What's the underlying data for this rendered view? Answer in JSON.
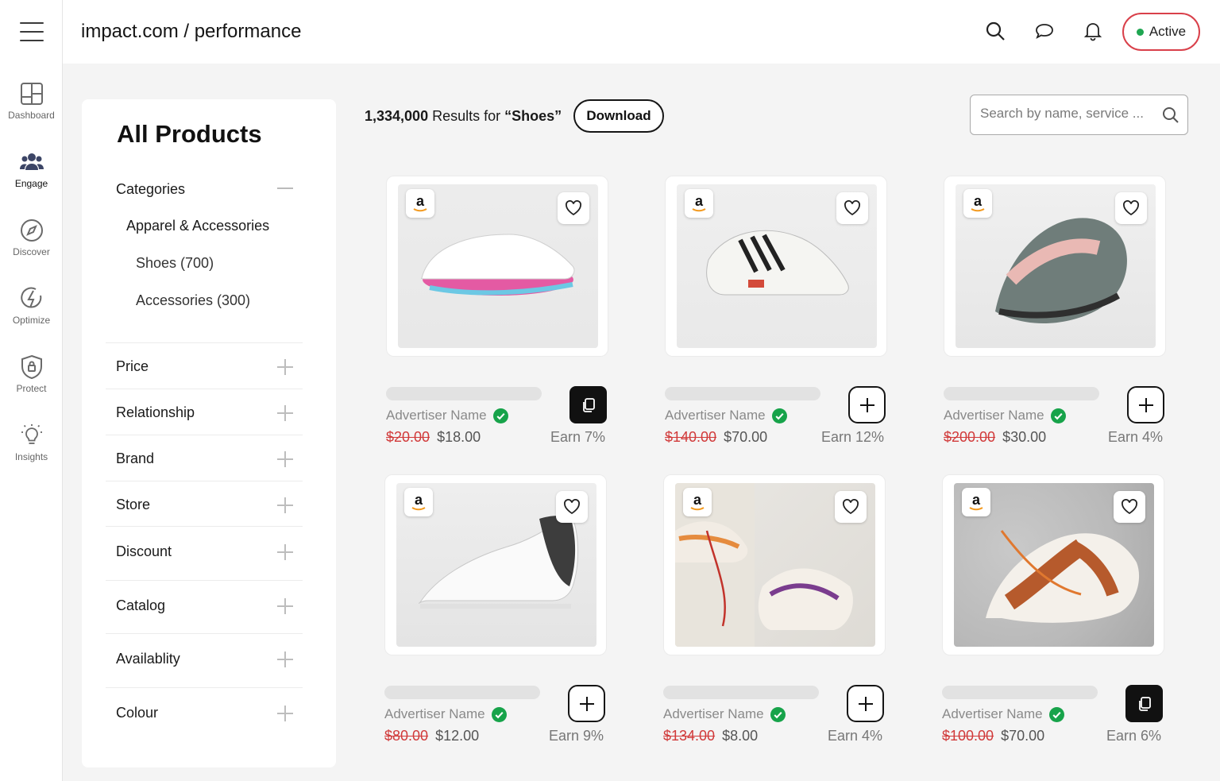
{
  "app": {
    "breadcrumb": "impact.com / performance"
  },
  "rail": {
    "items": [
      {
        "label": "Dashboard",
        "icon": "dashboard-icon"
      },
      {
        "label": "Engage",
        "icon": "users-icon"
      },
      {
        "label": "Discover",
        "icon": "compass-icon"
      },
      {
        "label": "Optimize",
        "icon": "bolt-icon"
      },
      {
        "label": "Protect",
        "icon": "shield-icon"
      },
      {
        "label": "Insights",
        "icon": "lightbulb-icon"
      }
    ]
  },
  "header": {
    "status_label": "Active",
    "status_color": "#1fa651",
    "accent": "#d9404a"
  },
  "filters": {
    "title": "All Products",
    "categories_label": "Categories",
    "category_l1": "Apparel & Accessories",
    "category_l2": [
      "Shoes (700)",
      "Accessories (300)"
    ],
    "rows": [
      "Price",
      "Relationship",
      "Brand",
      "Store",
      "Discount",
      "Catalog",
      "Availablity",
      "Colour"
    ]
  },
  "results": {
    "count": "1,334,000",
    "middle": " Results for ",
    "query": "“Shoes”",
    "download_label": "Download"
  },
  "search": {
    "placeholder": "Search by name, service ..."
  },
  "products": [
    {
      "advertiser": "Advertiser Name",
      "old_price": "$20.00",
      "price": "$18.00",
      "earn": "Earn 7%",
      "action": "copy"
    },
    {
      "advertiser": "Advertiser Name",
      "old_price": "$140.00",
      "price": "$70.00",
      "earn": "Earn 12%",
      "action": "add"
    },
    {
      "advertiser": "Advertiser Name",
      "old_price": "$200.00",
      "price": "$30.00",
      "earn": "Earn 4%",
      "action": "add"
    },
    {
      "advertiser": "Advertiser Name",
      "old_price": "$80.00",
      "price": "$12.00",
      "earn": "Earn 9%",
      "action": "add"
    },
    {
      "advertiser": "Advertiser Name",
      "old_price": "$134.00",
      "price": "$8.00",
      "earn": "Earn 4%",
      "action": "add"
    },
    {
      "advertiser": "Advertiser Name",
      "old_price": "$100.00",
      "price": "$70.00",
      "earn": "Earn 6%",
      "action": "copy"
    }
  ]
}
